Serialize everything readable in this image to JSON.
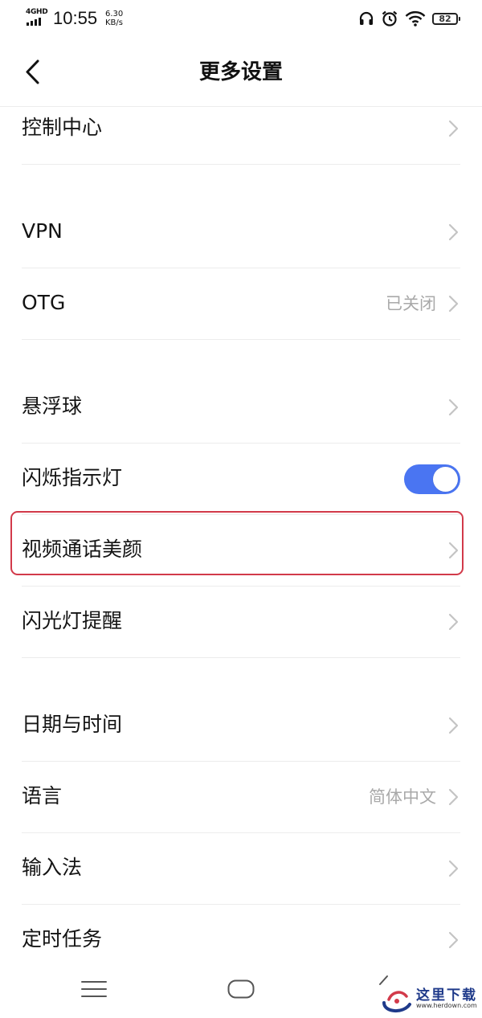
{
  "status_bar": {
    "network": "4GHD",
    "time": "10:55",
    "speed_value": "6.30",
    "speed_unit": "KB/s",
    "battery": "82",
    "icons": [
      "headset-icon",
      "alarm-icon",
      "wifi-icon",
      "battery-icon"
    ]
  },
  "header": {
    "title": "更多设置",
    "back_icon": "chevron-left-icon"
  },
  "groups": [
    {
      "rows": [
        {
          "label": "控制中心",
          "value": "",
          "control": "chevron"
        }
      ]
    },
    {
      "rows": [
        {
          "label": "VPN",
          "value": "",
          "control": "chevron"
        },
        {
          "label": "OTG",
          "value": "已关闭",
          "control": "chevron"
        }
      ]
    },
    {
      "rows": [
        {
          "label": "悬浮球",
          "value": "",
          "control": "chevron"
        },
        {
          "label": "闪烁指示灯",
          "value": "",
          "control": "toggle",
          "toggle_on": true
        },
        {
          "label": "视频通话美颜",
          "value": "",
          "control": "chevron",
          "highlighted": true
        },
        {
          "label": "闪光灯提醒",
          "value": "",
          "control": "chevron"
        }
      ]
    },
    {
      "rows": [
        {
          "label": "日期与时间",
          "value": "",
          "control": "chevron"
        },
        {
          "label": "语言",
          "value": "简体中文",
          "control": "chevron"
        },
        {
          "label": "输入法",
          "value": "",
          "control": "chevron"
        },
        {
          "label": "定时任务",
          "value": "",
          "control": "chevron"
        }
      ]
    }
  ],
  "colors": {
    "toggle_on": "#4a75f2",
    "highlight": "#d23a4a",
    "value_text": "#a9a9a9",
    "divider": "#ececec"
  },
  "nav_bar": {
    "icons": [
      "menu-icon",
      "home-icon",
      "back-icon"
    ]
  },
  "watermark": {
    "title": "这里下载",
    "url": "www.herdown.com"
  }
}
